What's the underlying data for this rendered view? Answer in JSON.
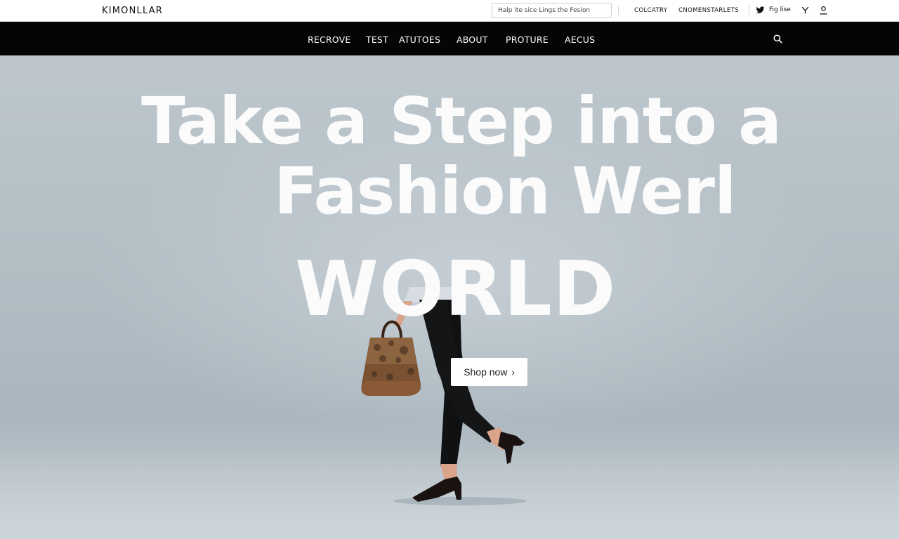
{
  "brand": {
    "logo_text": "KIMONLLAR"
  },
  "topbar": {
    "search_placeholder": "Halp ite sice Lings the Fesion",
    "links": [
      "COLCATRY",
      "CNOMENSTARLETS"
    ],
    "social_text": "Fig lise"
  },
  "nav": {
    "items": [
      "RECROVE",
      "TEST",
      "ATUTOES",
      "ABOUT",
      "PROTURE",
      "AECUS"
    ]
  },
  "hero": {
    "headline_line1": "Take a Step into a",
    "headline_line2": "Fashion Werl",
    "headline_line3": "WORLD",
    "cta_label": "Shop now",
    "cta_chevron": "›"
  },
  "icons": {
    "twitter": "twitter-icon",
    "social_y": "y-icon",
    "user": "user-icon",
    "search": "search-icon"
  },
  "colors": {
    "nav_background": "#050505",
    "hero_background": "#b9c3ca",
    "headline": "#fbfbfb",
    "cta_background": "#ffffff"
  }
}
